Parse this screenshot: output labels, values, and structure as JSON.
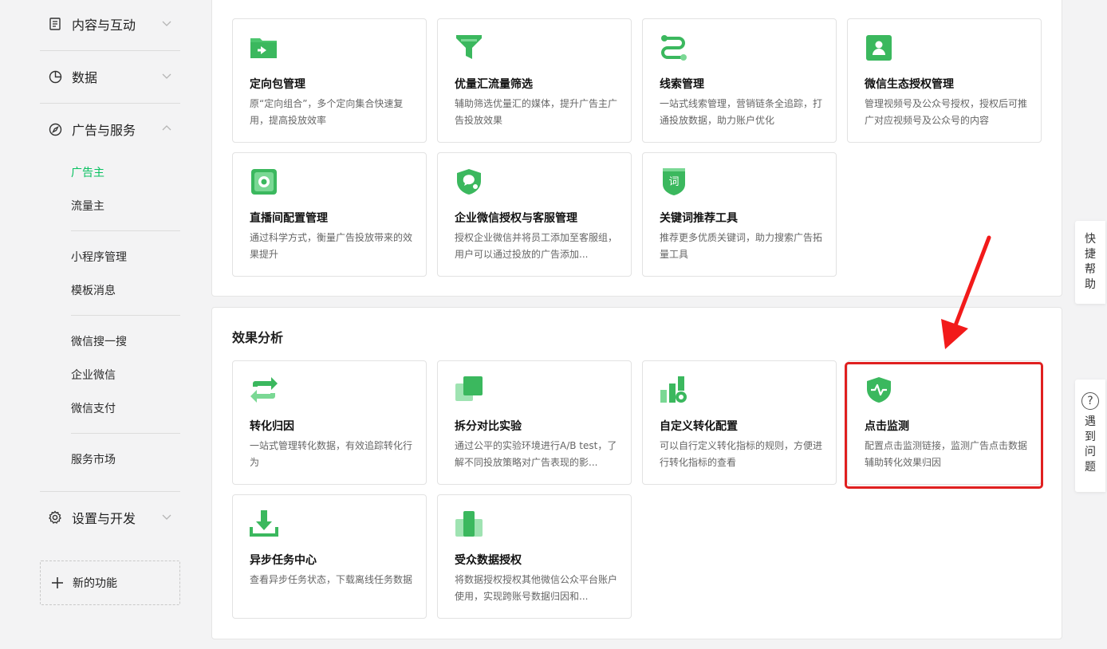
{
  "sidebar": {
    "groups": {
      "content": "内容与互动",
      "data": "数据",
      "ads": "广告与服务",
      "settings": "设置与开发"
    },
    "sub_items": {
      "advertiser": "广告主",
      "publisher": "流量主",
      "mini_program": "小程序管理",
      "template_msg": "模板消息",
      "wechat_search": "微信搜一搜",
      "wecom": "企业微信",
      "wechat_pay": "微信支付",
      "service_market": "服务市场"
    },
    "new_feature": "新的功能"
  },
  "top_cards": [
    {
      "title": "定向包管理",
      "desc": "原“定向组合”，多个定向集合快速复用，提高投放效率"
    },
    {
      "title": "优量汇流量筛选",
      "desc": "辅助筛选优量汇的媒体，提升广告主广告投放效果"
    },
    {
      "title": "线索管理",
      "desc": "一站式线索管理，营销链条全追踪，打通投放数据，助力账户优化"
    },
    {
      "title": "微信生态授权管理",
      "desc": "管理视频号及公众号授权，授权后可推广对应视频号及公众号的内容"
    },
    {
      "title": "直播间配置管理",
      "desc": "通过科学方式，衡量广告投放带来的效果提升"
    },
    {
      "title": "企业微信授权与客服管理",
      "desc": "授权企业微信并将员工添加至客服组，用户可以通过投放的广告添加..."
    },
    {
      "title": "关键词推荐工具",
      "desc": "推荐更多优质关键词，助力搜索广告拓量工具"
    }
  ],
  "analysis": {
    "section_title": "效果分析",
    "cards": [
      {
        "title": "转化归因",
        "desc": "一站式管理转化数据，有效追踪转化行为"
      },
      {
        "title": "拆分对比实验",
        "desc": "通过公平的实验环境进行A/B test，了解不同投放策略对广告表现的影..."
      },
      {
        "title": "自定义转化配置",
        "desc": "可以自行定义转化指标的规则，方便进行转化指标的查看"
      },
      {
        "title": "点击监测",
        "desc": "配置点击监测链接，监测广告点击数据辅助转化效果归因"
      },
      {
        "title": "异步任务中心",
        "desc": "查看异步任务状态，下载离线任务数据"
      },
      {
        "title": "受众数据授权",
        "desc": "将数据授权授权其他微信公众平台账户使用，实现跨账号数据归因和..."
      }
    ]
  },
  "right_float": {
    "quick_help": "快捷帮助",
    "problem": "遇到问题",
    "question_mark": "?"
  },
  "colors": {
    "accent": "#07c160",
    "highlight": "#e02020",
    "icon_green": "#48c774"
  }
}
